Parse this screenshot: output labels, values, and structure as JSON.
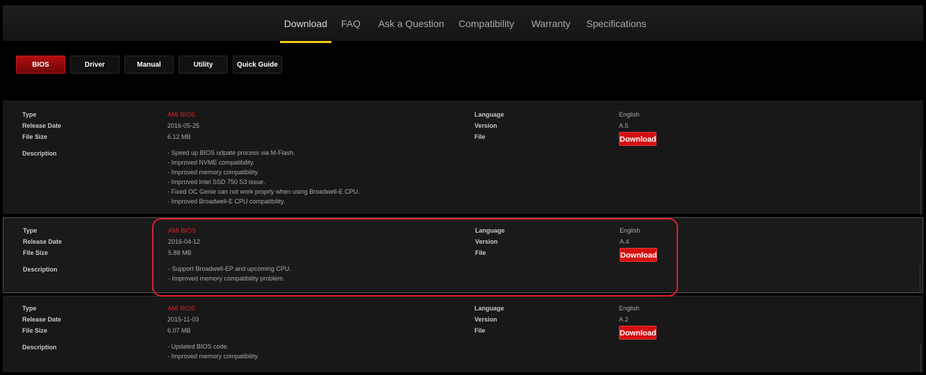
{
  "nav": {
    "tabs": [
      {
        "label": "Download",
        "active": true
      },
      {
        "label": "FAQ"
      },
      {
        "label": "Ask a Question"
      },
      {
        "label": "Compatibility"
      },
      {
        "label": "Warranty"
      },
      {
        "label": "Specifications"
      }
    ]
  },
  "categories": [
    {
      "label": "BIOS",
      "active": true
    },
    {
      "label": "Driver"
    },
    {
      "label": "Manual"
    },
    {
      "label": "Utility"
    },
    {
      "label": "Quick Guide"
    }
  ],
  "labels": {
    "type": "Type",
    "release_date": "Release Date",
    "file_size": "File Size",
    "description": "Description",
    "language": "Language",
    "version": "Version",
    "file": "File",
    "download": "Download"
  },
  "rows": [
    {
      "type": "AMI BIOS",
      "release_date": "2016-05-25",
      "file_size": "6.12 MB",
      "language": "English",
      "version": "A.5",
      "description": [
        "- Speed up BIOS udpate process via M-Flash.",
        "- Improved NVME compatibility.",
        "- Improved memory compatibility.",
        "- Improved Intel SSD 750 S3 issue.",
        "- Fixed OC Genie can not work proprly when using Broadwell-E CPU.",
        "- Improved Broadwell-E CPU compatibility."
      ]
    },
    {
      "type": "AMI BIOS",
      "release_date": "2016-04-12",
      "file_size": "5.88 MB",
      "language": "English",
      "version": "A.4",
      "description": [
        "- Support Broadwell-EP and upcoming CPU.",
        "- Improved memory compatibility problem."
      ]
    },
    {
      "type": "AMI BIOS",
      "release_date": "2015-11-03",
      "file_size": "6.07 MB",
      "language": "English",
      "version": "A.2",
      "description": [
        "- Updated BIOS code.",
        "- Improved memory compatibility."
      ]
    }
  ],
  "colors": {
    "accent_yellow": "#f2cc16",
    "brand_red": "#d40e0e",
    "annotation_red": "#e0212d"
  }
}
